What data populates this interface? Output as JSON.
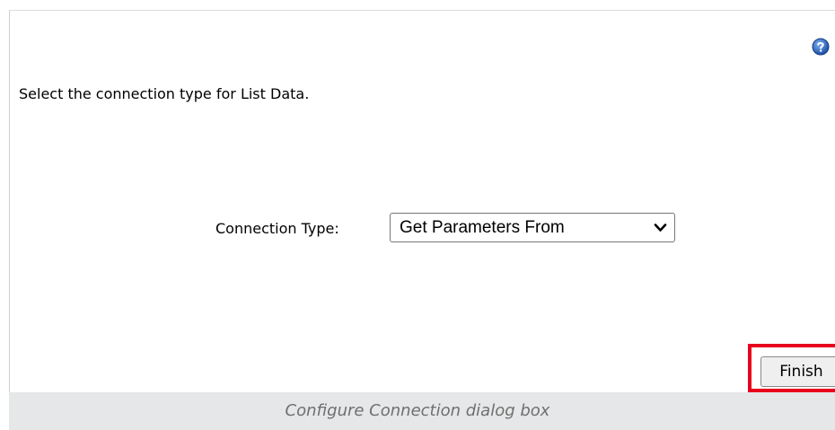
{
  "dialog": {
    "help_icon": "help-icon",
    "instruction": "Select the connection type for List Data.",
    "connection_type_label": "Connection Type:",
    "connection_type_value": "Get Parameters From",
    "finish_label": "Finish",
    "highlight_color": "#e8001c"
  },
  "caption": "Configure Connection dialog box"
}
